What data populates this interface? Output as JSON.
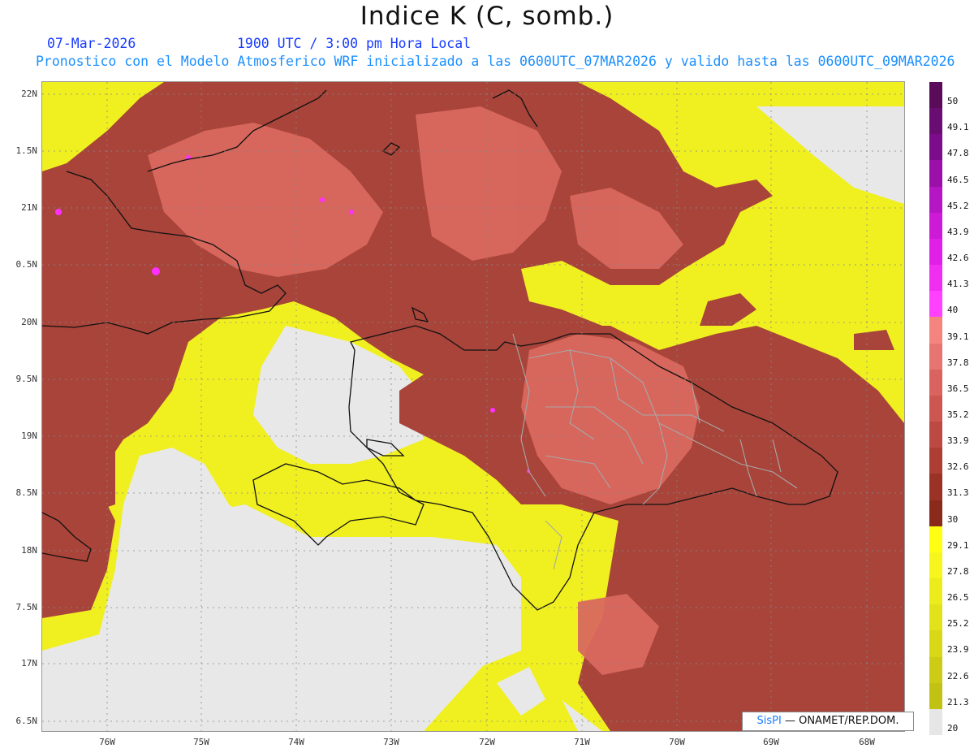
{
  "header": {
    "title": "Indice K (C, somb.)",
    "date": "07-Mar-2026",
    "time": "1900 UTC / 3:00 pm Hora Local",
    "subtitle": "Pronostico con el Modelo Atmosferico WRF inicializado a las 0600UTC_07MAR2026 y valido hasta las  0600UTC_09MAR2026"
  },
  "axes": {
    "lat_labels": [
      "22N",
      "1.5N",
      "21N",
      "0.5N",
      "20N",
      "9.5N",
      "19N",
      "8.5N",
      "18N",
      "7.5N",
      "17N",
      "6.5N"
    ],
    "lon_labels": [
      "76W",
      "75W",
      "74W",
      "73W",
      "72W",
      "71W",
      "70W",
      "69W",
      "68W"
    ]
  },
  "colorbar": {
    "labels": [
      "50",
      "49.1",
      "47.8",
      "46.5",
      "45.2",
      "43.9",
      "42.6",
      "41.3",
      "40",
      "39.1",
      "37.8",
      "36.5",
      "35.2",
      "33.9",
      "32.6",
      "31.3",
      "30",
      "29.1",
      "27.8",
      "26.5",
      "25.2",
      "23.9",
      "22.6",
      "21.3",
      "20"
    ],
    "colors": [
      "#5a0b5a",
      "#6a0d73",
      "#7d0c8c",
      "#9a10a8",
      "#b515c2",
      "#cc1ad6",
      "#e020e6",
      "#f02ef2",
      "#ff40ff",
      "#f4857e",
      "#e67470",
      "#d9645f",
      "#cc5650",
      "#bd4a42",
      "#ac3e34",
      "#9b3226",
      "#8a2a1a",
      "#ffff14",
      "#f6f61e",
      "#ecec1c",
      "#e2e21a",
      "#d8d818",
      "#cccc16",
      "#c2c214",
      "#e6e6e6"
    ],
    "colors_note_ignore": ""
  },
  "colors": {
    "no_data": "#e8e8e8",
    "yellow_band": "#f0f020",
    "red_band": "#b24a3e",
    "pink_band": "#d9685e",
    "magenta": "#ff30ff",
    "coast": "#111111",
    "provinces": "#a8a8a8",
    "grid": "#888888"
  },
  "credit": {
    "brand": "SisPI",
    "text": " — ONAMET/REP.DOM."
  }
}
